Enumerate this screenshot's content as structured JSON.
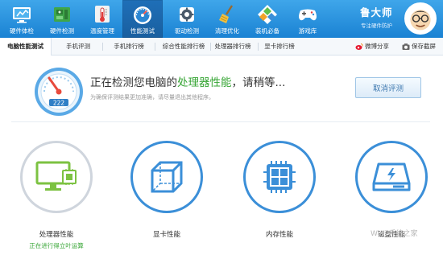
{
  "nav": {
    "items": [
      {
        "label": "硬件体检",
        "icon": "monitor-icon"
      },
      {
        "label": "硬件检测",
        "icon": "circuit-board-icon"
      },
      {
        "label": "温度管理",
        "icon": "thermometer-icon"
      },
      {
        "label": "性能测试",
        "icon": "speedometer-icon",
        "active": true
      },
      {
        "label": "驱动检测",
        "icon": "gear-icon"
      },
      {
        "label": "清理优化",
        "icon": "broom-icon"
      },
      {
        "label": "装机必备",
        "icon": "app-grid-icon"
      },
      {
        "label": "游戏库",
        "icon": "gamepad-icon"
      }
    ]
  },
  "brand": {
    "title": "鲁大师",
    "subtitle": "专注硬件防护"
  },
  "tabs": [
    {
      "label": "电脑性能测试",
      "active": true
    },
    {
      "label": "手机评测"
    },
    {
      "label": "手机排行榜"
    },
    {
      "label": "综合性能排行榜"
    },
    {
      "label": "处理器排行榜"
    },
    {
      "label": "显卡排行榜"
    }
  ],
  "tab_actions": {
    "share": "微博分享",
    "save": "保存截屏"
  },
  "status": {
    "title_prefix": "正在检测您电脑的",
    "title_highlight": "处理器性能",
    "title_suffix": "，请稍等...",
    "subtitle": "为确保评测结果更加准确，请尽量退出其他程序。",
    "cancel_label": "取消评测",
    "gauge_value": "222"
  },
  "cards": [
    {
      "label": "处理器性能",
      "status": "正在进行得立叶运算",
      "state": "active",
      "icon": "cpu-monitor-icon"
    },
    {
      "label": "显卡性能",
      "status": "",
      "state": "pending",
      "icon": "cube-icon"
    },
    {
      "label": "内存性能",
      "status": "",
      "state": "pending",
      "icon": "memory-chip-icon"
    },
    {
      "label": "磁盘性能",
      "status": "",
      "state": "pending",
      "icon": "hard-drive-icon"
    }
  ],
  "watermark": "Win7系统之家",
  "colors": {
    "toolbar_top": "#3fa6ea",
    "toolbar_bottom": "#1a82d3",
    "accent_blue": "#3b8fd8",
    "progress_green": "#36a534",
    "gauge_red": "#e84a3c"
  }
}
